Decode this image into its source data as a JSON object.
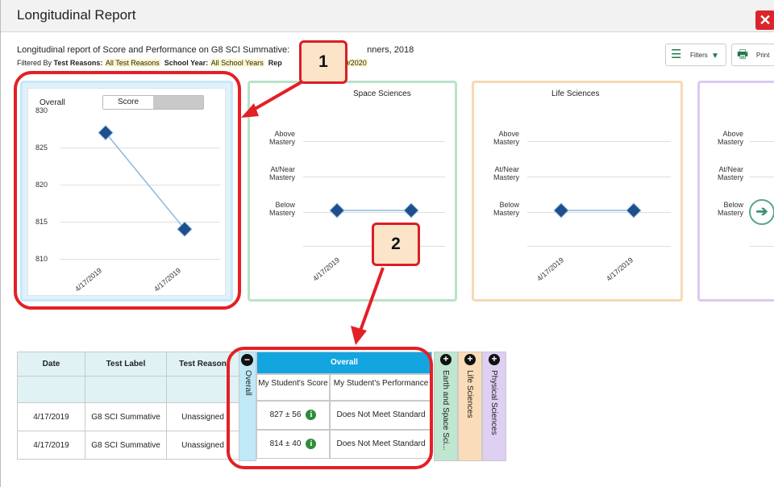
{
  "window": {
    "title": "Longitudinal Report",
    "close_icon": "close-icon"
  },
  "header": {
    "subtitle": "Longitudinal report of Score and Performance on G8 SCI Summative:",
    "subtitle_tail": "nners, 2018",
    "filter_prefix": "Filtered By",
    "filter_test_reasons_label": "Test Reasons:",
    "filter_test_reasons_value": "All Test Reasons",
    "filter_school_year_label": "School Year:",
    "filter_school_year_value": "All School Years",
    "filter_rep_label": "Rep",
    "filter_rep_value": "7/20/2020"
  },
  "toolbar": {
    "filters_label": "Filters",
    "print_label": "Print"
  },
  "cards": {
    "overall": {
      "title": "Overall",
      "toggle_selected": "Score",
      "yticks": [
        "830",
        "825",
        "820",
        "815",
        "810"
      ],
      "xticks": [
        "4/17/2019",
        "4/17/2019"
      ]
    },
    "earth": {
      "title": "Space Sciences",
      "levels": [
        "Above\nMastery",
        "At/Near\nMastery",
        "Below\nMastery"
      ],
      "xticks": [
        "4/17/2019",
        "4/17/2019"
      ]
    },
    "life": {
      "title": "Life Sciences",
      "levels": [
        "Above\nMastery",
        "At/Near\nMastery",
        "Below\nMastery"
      ],
      "xticks": [
        "4/17/2019",
        "4/17/2019"
      ]
    },
    "phys": {
      "levels": [
        "Above\nMastery",
        "At/Near\nMastery",
        "Below\nMastery"
      ],
      "xticks": [
        "4/17/"
      ]
    }
  },
  "chart_data": [
    {
      "type": "line",
      "title": "Overall",
      "x": [
        "4/17/2019",
        "4/17/2019"
      ],
      "series": [
        {
          "values": [
            827,
            814
          ]
        }
      ],
      "ylim": [
        810,
        830
      ],
      "yticks": [
        830,
        825,
        820,
        815,
        810
      ]
    },
    {
      "type": "line",
      "title": "Space Sciences",
      "x": [
        "4/17/2019",
        "4/17/2019"
      ],
      "series": [
        {
          "values": [
            "Below Mastery",
            "Below Mastery"
          ]
        }
      ]
    },
    {
      "type": "line",
      "title": "Life Sciences",
      "x": [
        "4/17/2019",
        "4/17/2019"
      ],
      "series": [
        {
          "values": [
            "Below Mastery",
            "Below Mastery"
          ]
        }
      ]
    }
  ],
  "callouts": {
    "one": "1",
    "two": "2"
  },
  "table": {
    "headers": [
      "Date",
      "Test Label",
      "Test Reason"
    ],
    "overall_col_label": "Overall",
    "overall_header": "Overall",
    "score_header": "My Student's Score",
    "performance_header": "My Student's Performance",
    "rows": [
      {
        "date": "4/17/2019",
        "label": "G8 SCI Summative",
        "reason": "Unassigned",
        "score": "827 ± 56",
        "performance": "Does Not Meet Standard"
      },
      {
        "date": "4/17/2019",
        "label": "G8 SCI Summative",
        "reason": "Unassigned",
        "score": "814 ± 40",
        "performance": "Does Not Meet Standard"
      }
    ],
    "side_cols": [
      "Earth and Space Sci...",
      "Life Sciences",
      "Physical Sciences"
    ]
  },
  "colors": {
    "accent": "#13a5e0",
    "close": "#d9252b",
    "marker": "#1f4e8c",
    "line": "#8bb9df",
    "highlight_red": "#e32025"
  }
}
